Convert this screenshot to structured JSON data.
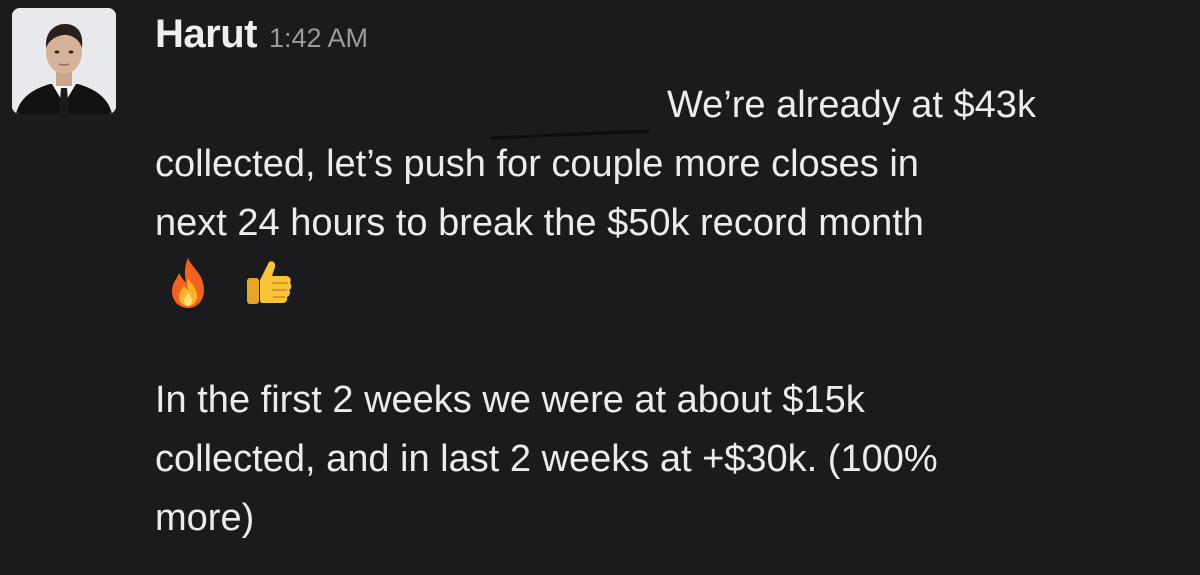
{
  "message": {
    "sender": "Harut",
    "timestamp": "1:42 AM",
    "lines_paragraph1": [
      "We’re already at $43k",
      "collected, let’s push for couple more closes in",
      "next 24 hours to break the $50k record month"
    ],
    "reactions_inline": [
      "fire-emoji",
      "thumbs-up-emoji"
    ],
    "lines_paragraph2": [
      "In the first 2 weeks we were at about $15k",
      "collected, and in last 2 weeks at +$30k. (100%",
      "more)"
    ]
  },
  "colors": {
    "background": "#1b1b1d",
    "text": "#ececec",
    "timestamp": "#9a9a9f"
  }
}
